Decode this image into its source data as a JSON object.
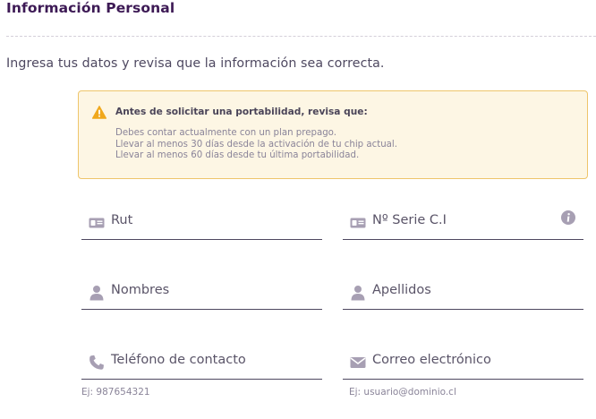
{
  "section": {
    "title": "Información Personal",
    "intro": "Ingresa tus datos y revisa que la información sea correcta."
  },
  "alert": {
    "title": "Antes de solicitar una portabilidad, revisa que:",
    "items": [
      "Debes contar actualmente con un plan prepago.",
      "Llevar al menos 30 días desde la activación de tu chip actual.",
      "Llevar al menos 60 días desde tu última portabilidad."
    ],
    "icon": "warning-icon",
    "accent": "#f0a81c"
  },
  "form": {
    "rut": {
      "label": "Rut",
      "icon": "id-card-icon"
    },
    "serie": {
      "label": "Nº Serie C.I",
      "icon": "id-card-icon",
      "info_icon": "info-icon"
    },
    "nombres": {
      "label": "Nombres",
      "icon": "user-icon"
    },
    "apellidos": {
      "label": "Apellidos",
      "icon": "user-icon"
    },
    "telefono": {
      "label": "Teléfono de contacto",
      "icon": "phone-icon",
      "hint": "Ej: 987654321"
    },
    "correo": {
      "label": "Correo electrónico",
      "icon": "envelope-icon",
      "hint": "Ej: usuario@dominio.cl"
    }
  },
  "colors": {
    "title": "#3d1a55",
    "icon": "#a79fb3",
    "alert_bg": "#fdf6e4",
    "alert_border": "#eec56b"
  }
}
